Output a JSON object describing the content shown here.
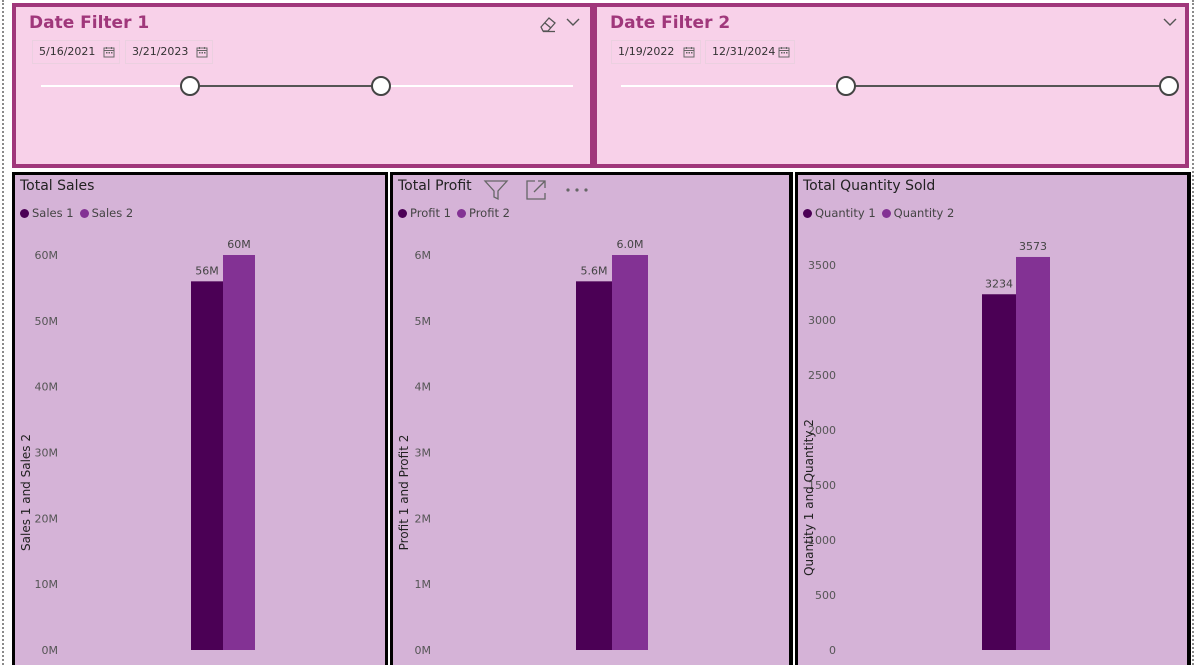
{
  "colors": {
    "series1": "#4b0055",
    "series2": "#833294",
    "slicer_bg": "#f8d1e9",
    "slicer_border": "#a0377b",
    "panel_bg": "#d5b3d7"
  },
  "slicers": [
    {
      "title": "Date Filter 1",
      "start_date": "5/16/2021",
      "end_date": "3/21/2023",
      "range_start_fraction": 0.28,
      "range_end_fraction": 0.64,
      "icons": [
        "eraser-icon",
        "chevron-down-icon",
        "calendar-icon"
      ]
    },
    {
      "title": "Date Filter 2",
      "start_date": "1/19/2022",
      "end_date": "12/31/2024",
      "range_start_fraction": 0.41,
      "range_end_fraction": 1.0,
      "icons": [
        "chevron-down-icon",
        "calendar-icon"
      ]
    }
  ],
  "visual_header_icons": [
    "filter-icon",
    "focus-mode-icon",
    "more-options-icon"
  ],
  "chart_data": [
    {
      "type": "bar",
      "title": "Total Sales",
      "categories": [
        ""
      ],
      "series": [
        {
          "name": "Sales 1",
          "values": [
            56000000
          ],
          "label": "56M"
        },
        {
          "name": "Sales 2",
          "values": [
            60000000
          ],
          "label": "60M"
        }
      ],
      "xlabel": "",
      "ylabel": "Sales 1 and Sales 2",
      "ylim": [
        0,
        60000000
      ],
      "yticks": [
        0,
        10000000,
        20000000,
        30000000,
        40000000,
        50000000,
        60000000
      ],
      "yticklabels": [
        "0M",
        "10M",
        "20M",
        "30M",
        "40M",
        "50M",
        "60M"
      ],
      "grid": false,
      "legend": "top-left"
    },
    {
      "type": "bar",
      "title": "Total Profit",
      "categories": [
        ""
      ],
      "series": [
        {
          "name": "Profit 1",
          "values": [
            5600000
          ],
          "label": "5.6M"
        },
        {
          "name": "Profit 2",
          "values": [
            6000000
          ],
          "label": "6.0M"
        }
      ],
      "xlabel": "",
      "ylabel": "Profit 1 and Profit 2",
      "ylim": [
        0,
        6000000
      ],
      "yticks": [
        0,
        1000000,
        2000000,
        3000000,
        4000000,
        5000000,
        6000000
      ],
      "yticklabels": [
        "0M",
        "1M",
        "2M",
        "3M",
        "4M",
        "5M",
        "6M"
      ],
      "grid": false,
      "legend": "top-left"
    },
    {
      "type": "bar",
      "title": "Total Quantity Sold",
      "categories": [
        ""
      ],
      "series": [
        {
          "name": "Quantity 1",
          "values": [
            3234
          ],
          "label": "3234"
        },
        {
          "name": "Quantity 2",
          "values": [
            3573
          ],
          "label": "3573"
        }
      ],
      "xlabel": "",
      "ylabel": "Quantity 1 and Quantity 2",
      "ylim": [
        0,
        3500
      ],
      "yticks": [
        0,
        500,
        1000,
        1500,
        2000,
        2500,
        3000,
        3500
      ],
      "yticklabels": [
        "0",
        "500",
        "1000",
        "1500",
        "2000",
        "2500",
        "3000",
        "3500"
      ],
      "grid": false,
      "legend": "top-left"
    }
  ]
}
